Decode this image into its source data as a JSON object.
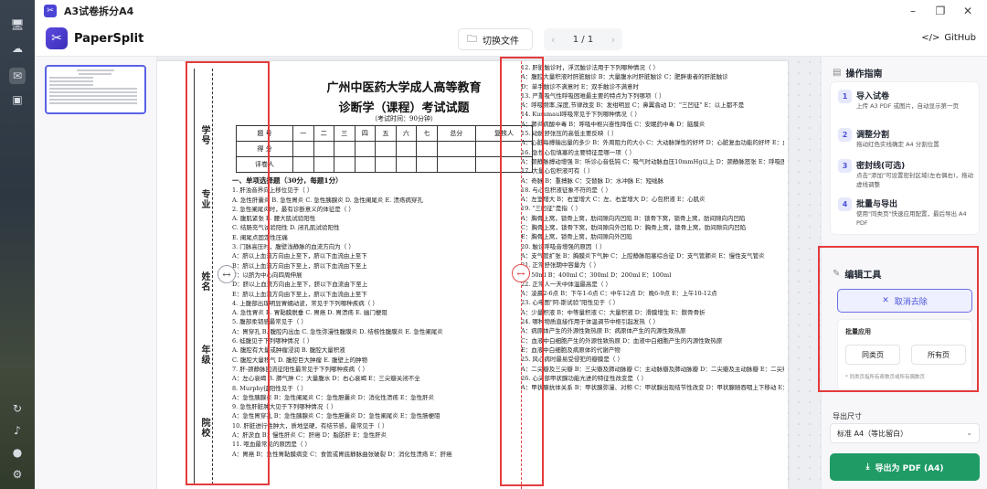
{
  "window": {
    "title": "A3试卷拆分A4",
    "app_icon": "scissors-icon"
  },
  "header": {
    "brand": "PaperSplit",
    "switch_file": "切换文件",
    "page_indicator": "1 / 1",
    "github": "GitHub"
  },
  "paper": {
    "title": "广州中医药大学成人高等教育",
    "subtitle": "诊断学（课程）考试试题",
    "time": "（考试时间：90分钟）",
    "score_headers": [
      "题 号",
      "一",
      "二",
      "三",
      "四",
      "五",
      "六",
      "七",
      "总分",
      "复核人"
    ],
    "score_rows": [
      "得 分",
      "评卷人"
    ],
    "binding_labels": [
      "学号",
      "专业",
      "姓名",
      "年级",
      "院校"
    ],
    "left_questions": [
      "一、单项选择题（30分，每题1分）",
      "1. 肝浊音界向上移位见于（ ）",
      "A. 急性肝囊炎   B. 急性胃炎   C. 急性胰腺炎   D. 急性阑尾炎   E. 溃疡病穿孔",
      "2. 急性阑尾炎时，最有诊断意义的体征是（ ）",
      "A. 腹肌紧张   B. 腰大肌试验阳性",
      "C. 结肠充气试验阳性   D. 闭孔肌试验阳性",
      "E. 阑尾点固定性压痛",
      "3. 门脉高压时，腹壁浅静脉的血流方向为（ ）",
      "A：脐以上血流方向由上至下，脐以下血流由上至下",
      "B：脐以上血流方向由下至上，脐以下血流由下至上",
      "C：以脐为中心向四周伸展",
      "D：脐以上血流方向由上至下，脐以下血流由下至上",
      "E：脐以上血流方向由下至上，脐以下血流由上至下",
      "4. 上腹部出现明显胃蠕动波，常见于下列哪种疾病（ ）",
      "A. 急性胃炎   B. 胃黏膜脱垂   C. 胃癌   D. 胃溃疡   E. 幽门梗阻",
      "5. 腹部柔韧感最常见于（ ）",
      "A：胃穿孔   B. 腹腔内出血   C. 急性弥漫性腹膜炎   D. 结核性腹膜炎   E. 急性阑尾炎",
      "6. 蛙腹见于下列哪种情况（ ）",
      "A. 腹腔有大量或肿瘤浸润   B. 腹腔大量积液",
      "C. 腹腔大量积气   D. 腹腔巨大肿瘤   E. 腹壁上的肿物",
      "7. 肝-颈静脉回流征阳性最常见于下列哪种疾病（ ）",
      "A：左心衰竭   B. 肺气肿   C：大量腹水   D：右心衰竭   E：三尖瓣关闭不全",
      "8. Murphy征阳性见于（ ）",
      "A：急性胰腺炎   B：急性阑尾炎   C：急性胆囊炎   D：消化性溃疡   E：急性肝炎",
      "9. 急性肝脏肿大见于下列哪种情况（ ）",
      "A：急性胃穿孔   B：急性胰腺炎   C：急性胆囊炎   D：急性阑尾炎   E：急性肠梗阻",
      "10. 肝脏进行性肿大，质地坚硬，有结节感，最常见于（ ）",
      "A：肝淤血   B：慢性肝炎   C：肝癌   D：脂肪肝   E：急性肝炎",
      "11. 呕血最常见的原因是（ ）",
      "A：胃癌   B：急性胃黏膜病变   C：食管或胃底静脉曲张破裂   D：消化性溃疡   E：肝癌"
    ],
    "right_questions": [
      "12. 肝脏触诊时，浮沉触诊法用于下列哪种情况（ ）",
      "A：腹腔大量积液时肝脏触诊   B：大量腹水时肝脏触诊   C：肥胖患者的肝脏触诊",
      "D：单手触诊不满意时   E：双手触诊不满意时",
      "13. 严重吸气性呼吸困难最主要的特点为下列哪项（ ）",
      "A：呼吸频率,深度,节律改变   B：发绀明显   C：鼻翼翕动   D：\"三凹征\"   E：以上都不是",
      "14. Kussmaul呼吸常见于下列哪种情况（ ）",
      "A：肺炎病酸中毒   B：呼吸中枢兴奋性降低   C：安眠药中毒   D：脑膜炎",
      "15. 动脉舒张压的高低主要反映（ ）",
      "A：心脏每搏输出量的多少   B：外周阻力的大小   C：大动脉弹性的好坏   D：心脏复血功能的好坏   E：血管充盈的程度",
      "16. 急性心包填塞的主要特征是哪一项（ ）",
      "A：颈静脉搏动增强   B：听诊心音低钝   C：吸气时动脉血压10mmHg以上   D：颈静脉怒张   E：呼吸困难",
      "17. 大量心包积液可有（ ）",
      "A：奇脉   B：重搏脉   C：交替脉   D：水冲脉   E：短绌脉",
      "18. 与心包积液征象不符的是（ ）",
      "A：左室增大   B：右室增大   C：左、右室增大   D：心包积液   E：心肌炎",
      "19. \"三凹征\"是指（ ）",
      "A：胸骨上窝，锁骨上窝，肋间隙向内凹陷   B：锁骨下窝，锁骨上窝，肋间隙向内凹陷",
      "C：胸骨上窝，锁骨下窝，肋间隙向外凹陷   D：胸骨上窝，锁骨上窝，肋间隙向内凹陷",
      "E：胸骨上窝，锁骨上窝，肋间隙向外凹陷",
      "20. 触诊呼吸音增强的原因（ ）",
      "A：支气管扩张   B：胸膜炎下气肿   C：上腔静脉阻塞综合征   D：支气管肺炎   E：慢性支气管炎",
      "21. 正常舒张期中容量为（ ）",
      "A：50ml   B：400ml   C：300ml   D：200ml   E：100ml",
      "22. 正常人一天中体温最高是（ ）",
      "A：凌晨2-6点   B：下午1-6点   C：中午12点   D：晚6-9点   E：上午10-12点",
      "23. 心电图\"阿-斯试验\"阳性见于（ ）",
      "A：少量积液   B：中等量积液   C：大量积液   D：滑膜增生   E：髌骨骨折",
      "24. 哪种物质直接作用于体温调节中枢引起发热（ ）",
      "A：病原体产生的外源性致热原   B：病原体产生的内源性致热原",
      "C：血液中白细胞产生的外源性致热原   D：血液中白细胞产生的内源性致热原",
      "E：血液中白细胞及病原体的代谢产物",
      "25. 风心病时最易受侵犯的瓣膜是（ ）",
      "A：二尖瓣及三尖瓣   B：三尖瓣及肺动脉瓣   C：主动脉瓣及肺动脉瓣   D：二尖瓣及主动脉瓣   E：二尖瓣及主动脉瓣",
      "26. 心尖部甲状腺功能亢进的特征性改变是（ ）",
      "A：甲状腺抗体关系   B：甲状腺弥漫、对称   C：甲状腺出现结节性改变   D：甲状腺随吞咽上下移动   E：可触及震颤或能听到杂音"
    ]
  },
  "panel": {
    "guide_title": "操作指南",
    "steps": [
      {
        "num": "1",
        "title": "导入试卷",
        "desc": "上传 A3 PDF 或图片，自动显示第一页"
      },
      {
        "num": "2",
        "title": "调整分割",
        "desc": "拖动红色实线确定 A4 分割位置"
      },
      {
        "num": "3",
        "title": "密封线(可选)",
        "desc": "点击\"添加\"可设置密封区域(左右偶右)，拖动虚线调整"
      },
      {
        "num": "4",
        "title": "批量与导出",
        "desc": "使用\"同类页\"快速应用配置，最后导出 A4 PDF"
      }
    ],
    "edit_title": "编辑工具",
    "cancel_remove": "取消去除",
    "batch_label": "批量应用",
    "same_pages": "同类页",
    "all_pages": "所有页",
    "batch_note": "* 同类页指所有奇数页或所有偶数页",
    "export_size_label": "导出尺寸",
    "export_size_value": "标准 A4（等比留白）",
    "export_button": "导出为 PDF (A4)"
  }
}
